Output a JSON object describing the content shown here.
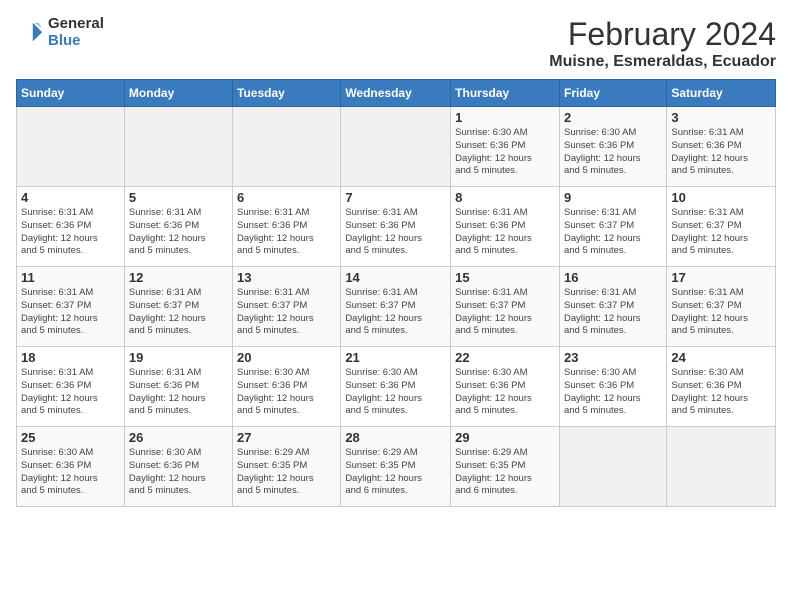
{
  "logo": {
    "general": "General",
    "blue": "Blue"
  },
  "title": "February 2024",
  "location": "Muisne, Esmeraldas, Ecuador",
  "days_header": [
    "Sunday",
    "Monday",
    "Tuesday",
    "Wednesday",
    "Thursday",
    "Friday",
    "Saturday"
  ],
  "weeks": [
    [
      {
        "num": "",
        "info": ""
      },
      {
        "num": "",
        "info": ""
      },
      {
        "num": "",
        "info": ""
      },
      {
        "num": "",
        "info": ""
      },
      {
        "num": "1",
        "info": "Sunrise: 6:30 AM\nSunset: 6:36 PM\nDaylight: 12 hours\nand 5 minutes."
      },
      {
        "num": "2",
        "info": "Sunrise: 6:30 AM\nSunset: 6:36 PM\nDaylight: 12 hours\nand 5 minutes."
      },
      {
        "num": "3",
        "info": "Sunrise: 6:31 AM\nSunset: 6:36 PM\nDaylight: 12 hours\nand 5 minutes."
      }
    ],
    [
      {
        "num": "4",
        "info": "Sunrise: 6:31 AM\nSunset: 6:36 PM\nDaylight: 12 hours\nand 5 minutes."
      },
      {
        "num": "5",
        "info": "Sunrise: 6:31 AM\nSunset: 6:36 PM\nDaylight: 12 hours\nand 5 minutes."
      },
      {
        "num": "6",
        "info": "Sunrise: 6:31 AM\nSunset: 6:36 PM\nDaylight: 12 hours\nand 5 minutes."
      },
      {
        "num": "7",
        "info": "Sunrise: 6:31 AM\nSunset: 6:36 PM\nDaylight: 12 hours\nand 5 minutes."
      },
      {
        "num": "8",
        "info": "Sunrise: 6:31 AM\nSunset: 6:36 PM\nDaylight: 12 hours\nand 5 minutes."
      },
      {
        "num": "9",
        "info": "Sunrise: 6:31 AM\nSunset: 6:37 PM\nDaylight: 12 hours\nand 5 minutes."
      },
      {
        "num": "10",
        "info": "Sunrise: 6:31 AM\nSunset: 6:37 PM\nDaylight: 12 hours\nand 5 minutes."
      }
    ],
    [
      {
        "num": "11",
        "info": "Sunrise: 6:31 AM\nSunset: 6:37 PM\nDaylight: 12 hours\nand 5 minutes."
      },
      {
        "num": "12",
        "info": "Sunrise: 6:31 AM\nSunset: 6:37 PM\nDaylight: 12 hours\nand 5 minutes."
      },
      {
        "num": "13",
        "info": "Sunrise: 6:31 AM\nSunset: 6:37 PM\nDaylight: 12 hours\nand 5 minutes."
      },
      {
        "num": "14",
        "info": "Sunrise: 6:31 AM\nSunset: 6:37 PM\nDaylight: 12 hours\nand 5 minutes."
      },
      {
        "num": "15",
        "info": "Sunrise: 6:31 AM\nSunset: 6:37 PM\nDaylight: 12 hours\nand 5 minutes."
      },
      {
        "num": "16",
        "info": "Sunrise: 6:31 AM\nSunset: 6:37 PM\nDaylight: 12 hours\nand 5 minutes."
      },
      {
        "num": "17",
        "info": "Sunrise: 6:31 AM\nSunset: 6:37 PM\nDaylight: 12 hours\nand 5 minutes."
      }
    ],
    [
      {
        "num": "18",
        "info": "Sunrise: 6:31 AM\nSunset: 6:36 PM\nDaylight: 12 hours\nand 5 minutes."
      },
      {
        "num": "19",
        "info": "Sunrise: 6:31 AM\nSunset: 6:36 PM\nDaylight: 12 hours\nand 5 minutes."
      },
      {
        "num": "20",
        "info": "Sunrise: 6:30 AM\nSunset: 6:36 PM\nDaylight: 12 hours\nand 5 minutes."
      },
      {
        "num": "21",
        "info": "Sunrise: 6:30 AM\nSunset: 6:36 PM\nDaylight: 12 hours\nand 5 minutes."
      },
      {
        "num": "22",
        "info": "Sunrise: 6:30 AM\nSunset: 6:36 PM\nDaylight: 12 hours\nand 5 minutes."
      },
      {
        "num": "23",
        "info": "Sunrise: 6:30 AM\nSunset: 6:36 PM\nDaylight: 12 hours\nand 5 minutes."
      },
      {
        "num": "24",
        "info": "Sunrise: 6:30 AM\nSunset: 6:36 PM\nDaylight: 12 hours\nand 5 minutes."
      }
    ],
    [
      {
        "num": "25",
        "info": "Sunrise: 6:30 AM\nSunset: 6:36 PM\nDaylight: 12 hours\nand 5 minutes."
      },
      {
        "num": "26",
        "info": "Sunrise: 6:30 AM\nSunset: 6:36 PM\nDaylight: 12 hours\nand 5 minutes."
      },
      {
        "num": "27",
        "info": "Sunrise: 6:29 AM\nSunset: 6:35 PM\nDaylight: 12 hours\nand 5 minutes."
      },
      {
        "num": "28",
        "info": "Sunrise: 6:29 AM\nSunset: 6:35 PM\nDaylight: 12 hours\nand 6 minutes."
      },
      {
        "num": "29",
        "info": "Sunrise: 6:29 AM\nSunset: 6:35 PM\nDaylight: 12 hours\nand 6 minutes."
      },
      {
        "num": "",
        "info": ""
      },
      {
        "num": "",
        "info": ""
      }
    ]
  ]
}
